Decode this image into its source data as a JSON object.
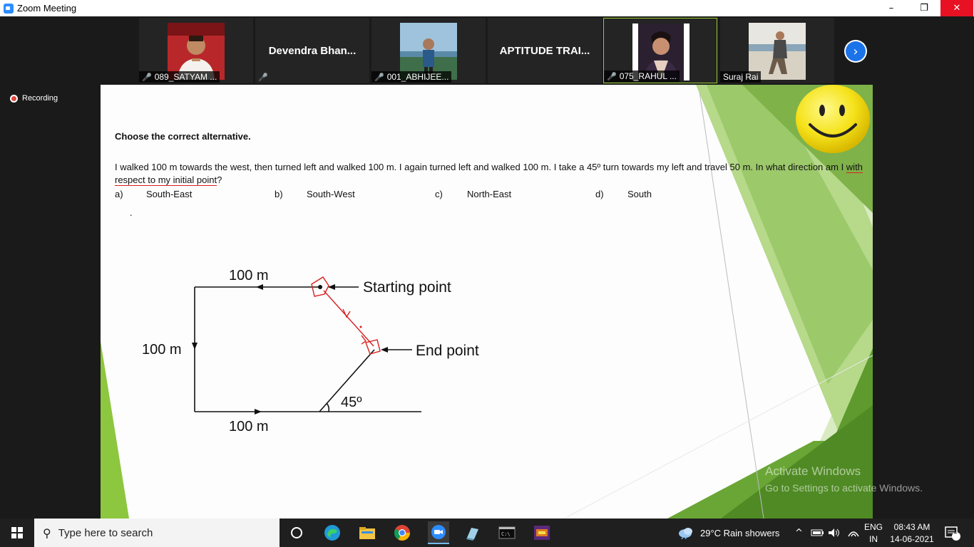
{
  "window": {
    "title": "Zoom Meeting",
    "minimize": "–",
    "maximize": "❐",
    "close": "✕"
  },
  "participants": [
    {
      "name": "089_SATYAM ...",
      "muted": true,
      "has_photo": true,
      "photo_bg": "#b8282a"
    },
    {
      "name": "Devendra  Bhan...",
      "muted": true,
      "has_photo": false
    },
    {
      "name": "001_ABHIJEE...",
      "muted": true,
      "has_photo": true,
      "photo_bg": "#7aa7c8"
    },
    {
      "name": "APTITUDE TRAI...",
      "muted": false,
      "has_photo": false
    },
    {
      "name": "075_RAHUL ...",
      "muted": true,
      "has_photo": true,
      "photo_bg": "#2a2030",
      "active": true
    },
    {
      "name": "Suraj Rai",
      "muted": false,
      "has_photo": true,
      "photo_bg": "#c8b89a"
    }
  ],
  "next_icon": "chevron-right",
  "recording": {
    "label": "Recording"
  },
  "slide": {
    "heading": "Choose the correct alternative.",
    "question_part1": "I walked 100 m towards the west, then turned left and walked 100 m. I again turned left and walked 100 m. I take a 45º turn towards my left and travel 50 m. In what direction am I ",
    "question_underlined": "with respect to my initial point",
    "question_end": "?",
    "options": [
      {
        "key": "a)",
        "text": "South-East"
      },
      {
        "key": "b)",
        "text": "South-West"
      },
      {
        "key": "c)",
        "text": "North-East"
      },
      {
        "key": "d)",
        "text": "South"
      }
    ],
    "dot": ".",
    "diagram": {
      "top_label": "100 m",
      "left_label": "100 m",
      "bottom_label": "100 m",
      "angle_label": "45º",
      "start_label": "Starting point",
      "end_label": "End point"
    }
  },
  "watermark": {
    "line1": "Activate Windows",
    "line2": "Go to Settings to activate Windows."
  },
  "taskbar": {
    "search_placeholder": "Type here to search",
    "weather": "29°C  Rain showers",
    "lang_top": "ENG",
    "lang_bottom": "IN",
    "time": "08:43 AM",
    "date": "14-06-2021",
    "notifications": "1"
  },
  "colors": {
    "accent_green": "#7dc242",
    "zoom_blue": "#2d8cff",
    "close_red": "#e81123",
    "annotation_red": "#d82020"
  }
}
